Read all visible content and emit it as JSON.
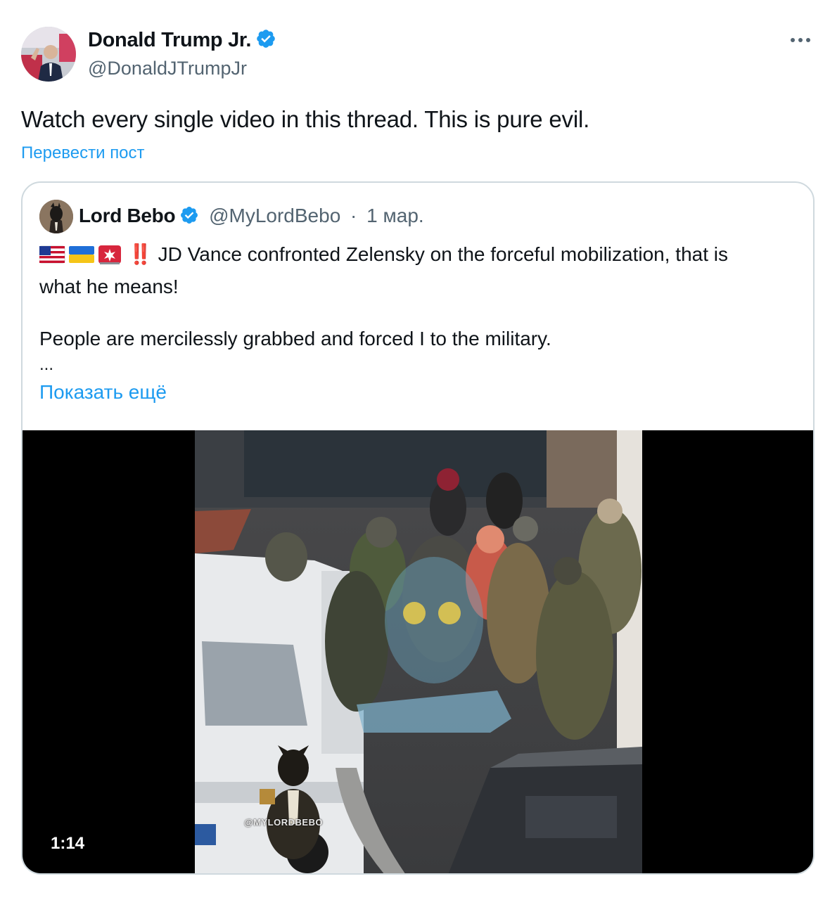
{
  "post": {
    "author_name": "Donald Trump Jr.",
    "author_handle": "@DonaldJTrumpJr",
    "text": "Watch every single video in this thread. This is pure evil.",
    "translate_label": "Перевести пост"
  },
  "quote": {
    "author_name": "Lord Bebo",
    "author_handle": "@MyLordBebo",
    "separator": "·",
    "date": "1 мар.",
    "text_line1": "‼️ JD Vance confronted Zelensky on the forceful mobilization, that is",
    "text_line2": "what he means!",
    "text_p2": "People are mercilessly grabbed and forced I to the military.",
    "ellipsis": "...",
    "show_more_label": "Показать ещё",
    "video_watermark": "@MYLORDBEBO",
    "video_duration": "1:14"
  },
  "icons": {
    "verified": "verified-badge-icon",
    "more": "more-options-icon"
  },
  "colors": {
    "accent": "#1d9bf0",
    "secondary_text": "#536471",
    "border": "#cfd9de"
  }
}
